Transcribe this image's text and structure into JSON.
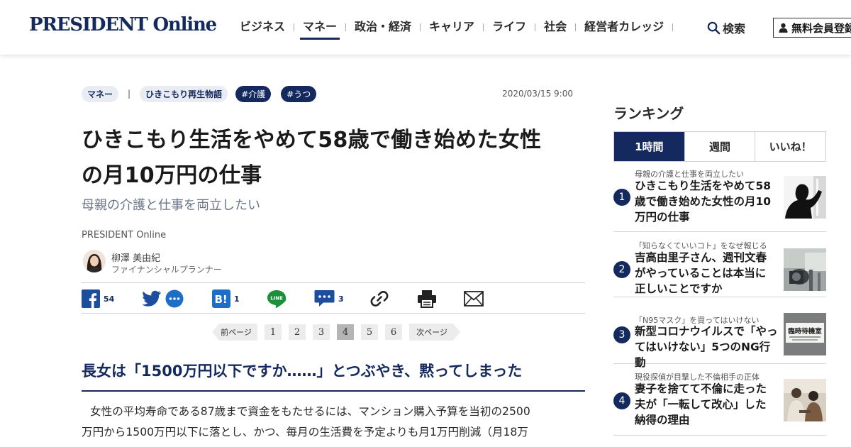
{
  "header": {
    "logo": "PRESIDENT Online",
    "nav": [
      "ビジネス",
      "マネー",
      "政治・経済",
      "キャリア",
      "ライフ",
      "社会",
      "経営者カレッジ"
    ],
    "active_nav": "マネー",
    "search_label": "検索",
    "member_label": "無料会員登録"
  },
  "article": {
    "category": "マネー",
    "series": "ひきこもり再生物語",
    "tags": [
      "#介護",
      "#うつ"
    ],
    "date": "2020/03/15 9:00",
    "title_line1": "ひきこもり生活をやめて58歳で働き始めた女性",
    "title_line2": "の月10万円の仕事",
    "subtitle": "母親の介護と仕事を両立したい",
    "publisher": "PRESIDENT Online",
    "author": {
      "name": "柳澤 美由紀",
      "role": "ファイナンシャルプランナー"
    },
    "share": {
      "facebook_count": "54",
      "hatena_count": "1",
      "comment_count": "3"
    },
    "pager": {
      "prev": "前ページ",
      "pages": [
        "1",
        "2",
        "3",
        "4",
        "5",
        "6"
      ],
      "current": "4",
      "next": "次ページ"
    },
    "section_title": "長女は「1500万円以下ですか……」とつぶやき、黙ってしまった",
    "body_line1": "女性の平均寿命である87歳まで資金をもたせるには、マンション購入予算を当初の2500",
    "body_line2": "万円から1500万円以下に落とし、かつ、毎月の生活費を予定よりも月1万円削減（月18万"
  },
  "sidebar": {
    "heading": "ランキング",
    "tabs": [
      "1時間",
      "週間",
      "いいね！"
    ],
    "active_tab": "1時間",
    "items": [
      {
        "rank": "1",
        "kicker": "母親の介護と仕事を両立したい",
        "title": "ひきこもり生活をやめて58歳で働き始めた女性の月10万円の仕事"
      },
      {
        "rank": "2",
        "kicker": "「知らなくていいコト」をなぜ報じる",
        "title": "吉高由里子さん、週刊文春がやっていることは本当に正しいことですか"
      },
      {
        "rank": "3",
        "kicker": "「N95マスク」を買ってはいけない",
        "title": "新型コロナウイルスで「やってはいけない」5つのNG行動"
      },
      {
        "rank": "4",
        "kicker": "現役探偵が目撃した不倫相手の正体",
        "title": "妻子を捨てて不倫に走った夫が「一転して改心」した納得の理由"
      }
    ],
    "thumb3_text": "臨時待機室"
  },
  "colors": {
    "brand_navy": "#142a5e",
    "chip_bg": "#e9edf3",
    "facebook": "#1877f2",
    "twitter": "#1da1f2",
    "hatena": "#00a4de",
    "line": "#06c755"
  }
}
